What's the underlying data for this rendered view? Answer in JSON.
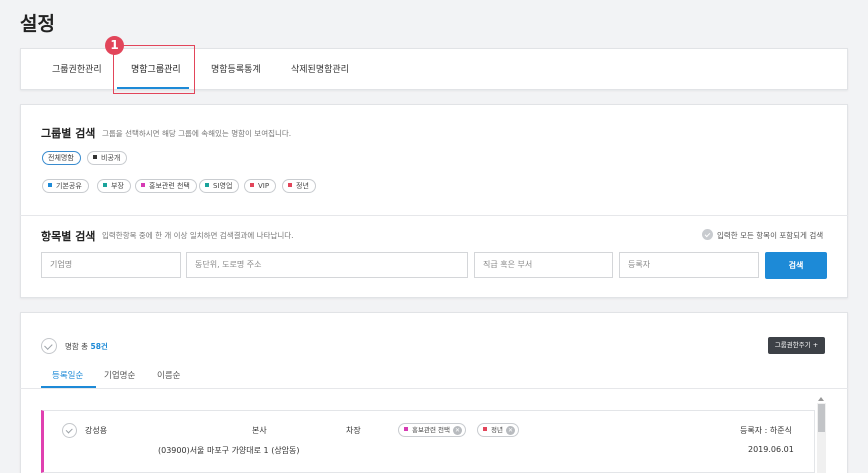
{
  "page": {
    "title": "설정"
  },
  "annotation": {
    "marker": "1"
  },
  "tabs": [
    {
      "label": "그룹권한관리"
    },
    {
      "label": "명함그룹관리",
      "active": true
    },
    {
      "label": "명함등록통계"
    },
    {
      "label": "삭제된명함관리"
    }
  ],
  "group_search": {
    "title": "그룹별 검색",
    "description": "그룹을 선택하시면 해당 그룹에 속해있는 명함이 보여집니다.",
    "row1": [
      {
        "label": "전체명함",
        "selected": true
      },
      {
        "label": "비공개",
        "color": "#333333"
      }
    ],
    "row2": [
      {
        "label": "기본공유",
        "color": "#1d8ad7"
      },
      {
        "label": "부장",
        "color": "#1aa39b"
      },
      {
        "label": "홍보관련 천택",
        "color": "#d63ab4"
      },
      {
        "label": "SI영업",
        "color": "#1aa39b"
      },
      {
        "label": "VIP",
        "color": "#e2455a"
      },
      {
        "label": "정년",
        "color": "#e2455a"
      }
    ]
  },
  "item_search": {
    "title": "항목별 검색",
    "description": "입력한항목 중에 한 개 이상 일치하면 검색결과에 나타납니다.",
    "include_all_label": "입력한 모든 항목이 포함되게 검색",
    "fields": [
      {
        "placeholder": "기업명"
      },
      {
        "placeholder": "동단위, 도로명 주소"
      },
      {
        "placeholder": "직급 혹은 부서"
      },
      {
        "placeholder": "등록자"
      }
    ],
    "search_button": "검색"
  },
  "list": {
    "total_prefix": "명함 총",
    "total_count": "58건",
    "group_button": "그룹권한주기 +",
    "sort_tabs": [
      {
        "label": "등록일순",
        "active": true
      },
      {
        "label": "기업명순"
      },
      {
        "label": "이름순"
      }
    ],
    "rows": [
      {
        "name": "강성용",
        "department": "본사",
        "position": "차장",
        "tags": [
          {
            "label": "홍보관련 천택",
            "color": "#d63ab4"
          },
          {
            "label": "정년",
            "color": "#e2455a"
          }
        ],
        "registrant": "등록자 : 하준식",
        "address": "(03900)서울 마포구 가양대로 1 (상암동)",
        "date": "2019.06.01"
      }
    ]
  }
}
